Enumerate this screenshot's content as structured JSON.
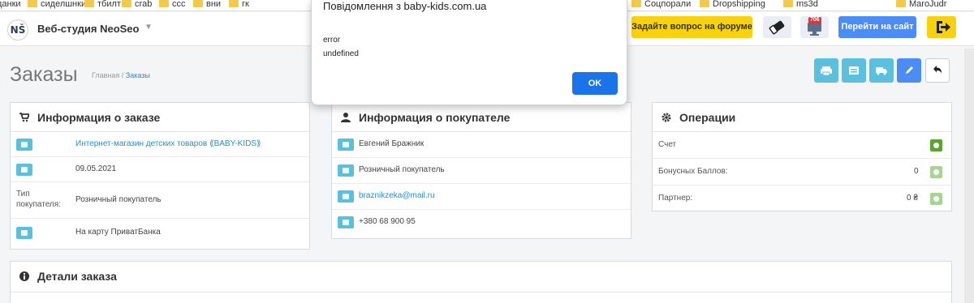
{
  "bookmarks": [
    "данки",
    "сиделшнки",
    "тбилт",
    "crab",
    "ccc",
    "вни",
    "гк",
    "Соцпорали",
    "Dropshipping",
    "ms3d",
    "MaroJudr"
  ],
  "header": {
    "logo_text": "NŠ",
    "studio_name": "Веб-студия NeoSeo",
    "forum_button": "Задайте вопрос на форуме",
    "eraser_icon": "eraser-icon",
    "notifications_badge": "706",
    "goto_site_button": "Перейти на сайт",
    "exit_icon": "sign-out-icon"
  },
  "page": {
    "title": "Заказы",
    "breadcrumb_home": "Главная",
    "breadcrumb_separator": "/",
    "breadcrumb_current": "Заказы"
  },
  "toolbar": {
    "icons": [
      "print-icon",
      "invoice-icon",
      "truck-icon",
      "pencil-icon",
      "reply-icon"
    ]
  },
  "order_info": {
    "title": "Информация о заказе",
    "store": "Интернет-магазин детских товаров ⟪BABY-KIDS⟫",
    "date": "09.05.2021",
    "customer_type_label": "Тип покупателя:",
    "customer_type_value": "Розничный покупатель",
    "payment": "На карту ПриватБанка"
  },
  "customer_info": {
    "title": "Информация о покупателе",
    "name": "Евгений Бражник",
    "group": "Розничный покупатель",
    "email": "braznikzeka@mail.ru",
    "phone": "+380 68 900 95"
  },
  "operations": {
    "title": "Операции",
    "invoice_label": "Счет",
    "bonus_label": "Бонусных Баллов:",
    "bonus_value": "0",
    "partner_label": "Партнер:",
    "partner_value": "0 ₴"
  },
  "details": {
    "title": "Детали заказа"
  },
  "dialog": {
    "title": "Повідомлення з baby-kids.com.ua",
    "line1": "error",
    "line2": "undefined",
    "ok_button": "OK"
  },
  "colors": {
    "accent_blue": "#4b8cf5",
    "info": "#5bc0de",
    "yellow": "#f8d10f",
    "success": "#5aa531"
  }
}
